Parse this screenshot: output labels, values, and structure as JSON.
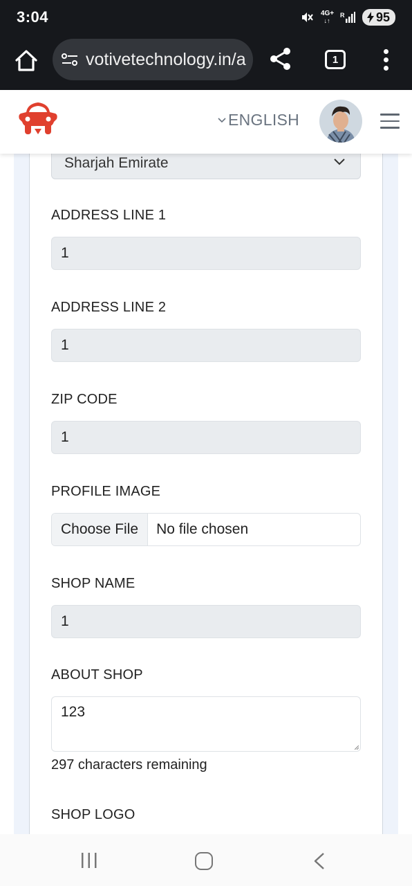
{
  "status_bar": {
    "time": "3:04",
    "network_top": "4G+",
    "network_sub": "R",
    "battery": "95"
  },
  "browser": {
    "url": "votivetechnology.in/a",
    "tab_count": "1"
  },
  "header": {
    "language": "ENGLISH"
  },
  "form": {
    "city_select_value": "Sharjah Emirate",
    "address1_label": "ADDRESS LINE 1",
    "address1_value": "1",
    "address2_label": "ADDRESS LINE 2",
    "address2_value": "1",
    "zip_label": "ZIP CODE",
    "zip_value": "1",
    "profile_image_label": "PROFILE IMAGE",
    "choose_file_label": "Choose File",
    "file_status": "No file chosen",
    "shop_name_label": "SHOP NAME",
    "shop_name_value": "1",
    "about_shop_label": "ABOUT SHOP",
    "about_shop_value": "123",
    "characters_remaining": "297 characters remaining",
    "shop_logo_label": "SHOP LOGO"
  },
  "colors": {
    "status_bg": "#16181c",
    "brand_red": "#e0402e",
    "input_bg": "#e9ecef",
    "panel_bg": "#eef3fb"
  },
  "icons": [
    "mute-icon",
    "signal-icon",
    "battery-icon",
    "home-icon",
    "site-settings-icon",
    "share-icon",
    "tabs-icon",
    "more-menu-icon",
    "car-logo-icon",
    "chevron-down-icon",
    "avatar",
    "hamburger-menu-icon",
    "recent-apps-icon",
    "nav-home-icon",
    "back-icon"
  ]
}
